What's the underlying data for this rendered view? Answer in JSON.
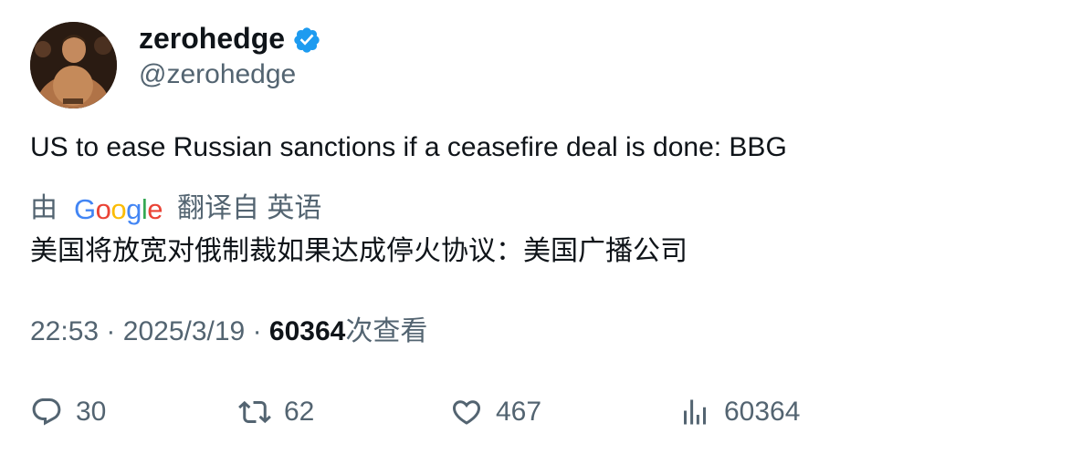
{
  "author": {
    "display_name": "zerohedge",
    "handle": "@zerohedge",
    "verified_icon": "verified-badge-icon",
    "colors": {
      "verified": "#1d9bf0"
    }
  },
  "tweet": {
    "text": "US to ease Russian sanctions if a ceasefire deal is done: BBG",
    "translation": {
      "prefix": "由",
      "provider": "Google",
      "suffix": "翻译自 英语",
      "text": "美国将放宽对俄制裁如果达成停火协议：美国广播公司"
    },
    "meta": {
      "time": "22:53",
      "separator": "·",
      "date": "2025/3/19",
      "views_count": "60364",
      "views_label": "次查看"
    }
  },
  "actions": {
    "reply": {
      "count": "30",
      "icon": "reply-icon"
    },
    "retweet": {
      "count": "62",
      "icon": "retweet-icon"
    },
    "like": {
      "count": "467",
      "icon": "heart-icon"
    },
    "views": {
      "count": "60364",
      "icon": "views-chart-icon"
    }
  }
}
